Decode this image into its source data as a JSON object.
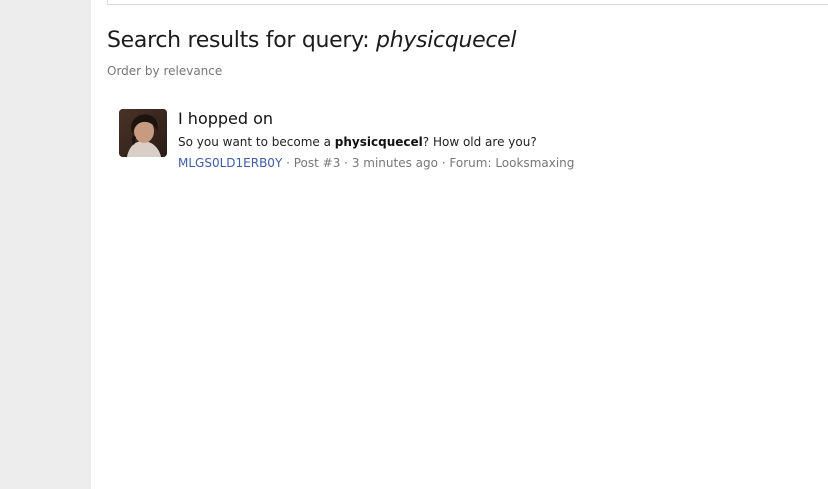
{
  "search": {
    "heading_prefix": "Search results for query: ",
    "query": "physicquecel",
    "order_label": "Order by relevance"
  },
  "results": [
    {
      "title": "I hopped on",
      "snippet_before": "So you want to become a ",
      "snippet_match": "physicquecel",
      "snippet_after": "? How old are you?",
      "author": "MLGS0LD1ERB0Y",
      "post_number": "Post #3",
      "time": "3 minutes ago",
      "forum_prefix": "Forum: ",
      "forum": "Looksmaxing",
      "separator": " · "
    }
  ],
  "colors": {
    "link": "#3f5ca8",
    "muted": "#777777",
    "sidebar": "#ededed"
  }
}
